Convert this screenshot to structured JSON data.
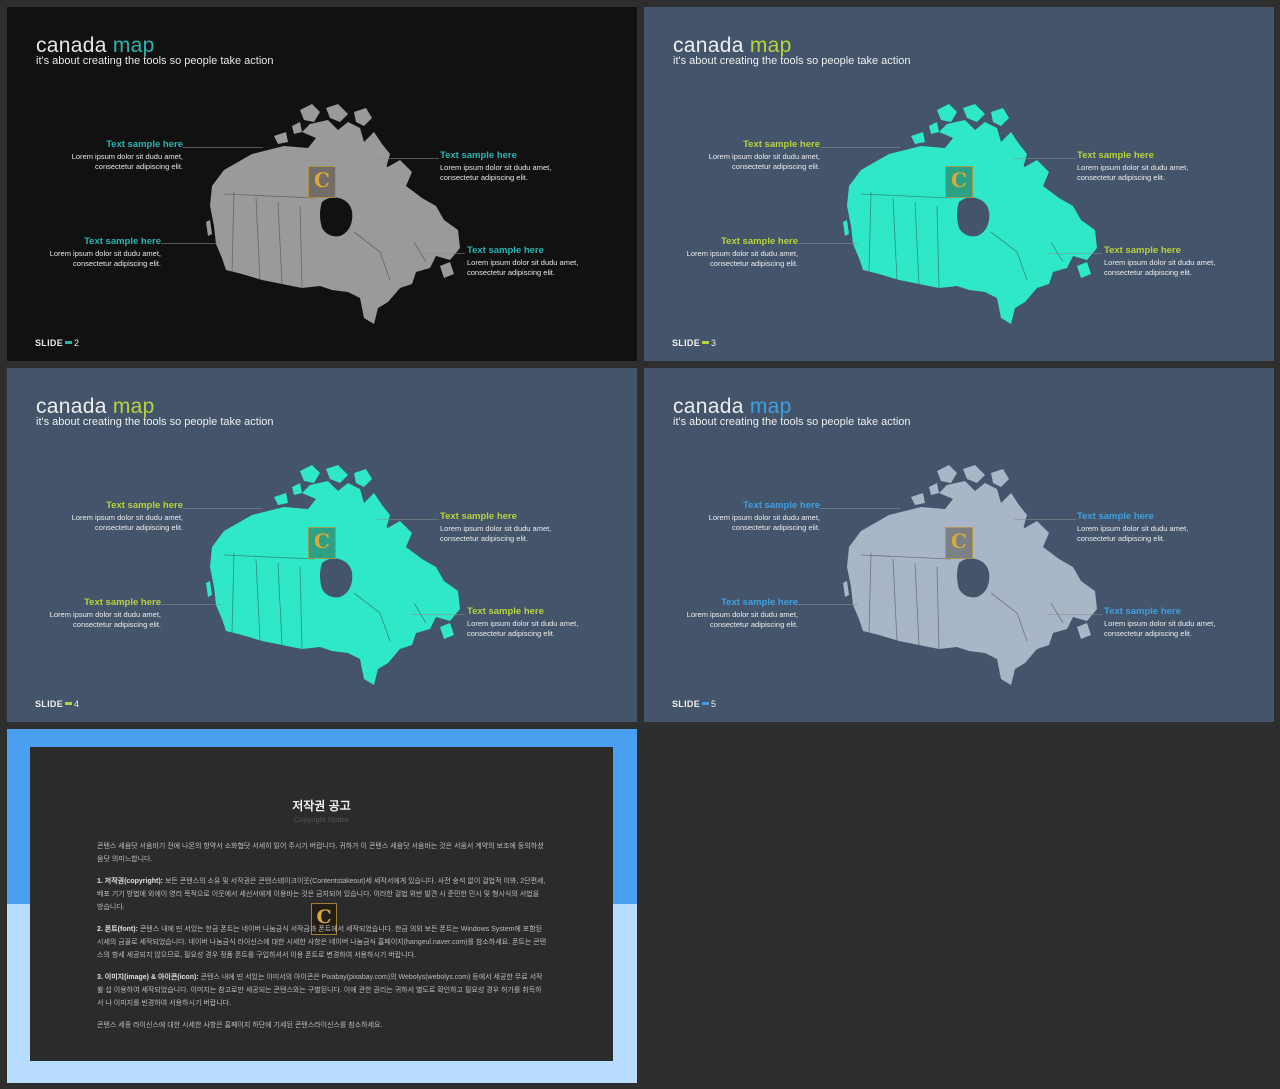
{
  "slides": [
    {
      "title_main": "canada",
      "title_accent": "map",
      "subtitle": "it's about creating the tools so people take action",
      "footer_label": "SLIDE",
      "footer_number": "2",
      "colors": {
        "background": "#111111",
        "accent": "#2bb3b0",
        "heading": "#2bb3b0",
        "map_fill": "#9a9a9a",
        "text": "#e6e6e6"
      },
      "callouts": [
        {
          "heading": "Text sample here",
          "body": "Lorem ipsum dolor sit dudu amet, consectetur adipiscing elit."
        },
        {
          "heading": "Text sample here",
          "body": "Lorem ipsum dolor sit dudu amet, consectetur adipiscing elit."
        },
        {
          "heading": "Text sample here",
          "body": "Lorem ipsum dolor sit dudu amet, consectetur adipiscing elit."
        },
        {
          "heading": "Text sample here",
          "body": "Lorem ipsum dolor sit dudu amet, consectetur adipiscing elit."
        }
      ]
    },
    {
      "title_main": "canada",
      "title_accent": "map",
      "subtitle": "it's about creating the tools so people take action",
      "footer_label": "SLIDE",
      "footer_number": "3",
      "colors": {
        "background": "#44546a",
        "accent": "#b7d33c",
        "heading": "#b7d33c",
        "map_fill": "#2ee8c7",
        "text": "#eeeeee"
      },
      "callouts": [
        {
          "heading": "Text sample here",
          "body": "Lorem ipsum dolor sit dudu amet, consectetur adipiscing elit."
        },
        {
          "heading": "Text sample here",
          "body": "Lorem ipsum dolor sit dudu amet, consectetur adipiscing elit."
        },
        {
          "heading": "Text sample here",
          "body": "Lorem ipsum dolor sit dudu amet, consectetur adipiscing elit."
        },
        {
          "heading": "Text sample here",
          "body": "Lorem ipsum dolor sit dudu amet, consectetur adipiscing elit."
        }
      ]
    },
    {
      "title_main": "canada",
      "title_accent": "map",
      "subtitle": "it's about creating the tools so people take action",
      "footer_label": "SLIDE",
      "footer_number": "4",
      "colors": {
        "background": "#44546a",
        "accent": "#b7d33c",
        "heading": "#b7d33c",
        "map_fill": "#2ee8c7",
        "text": "#eeeeee"
      },
      "callouts": [
        {
          "heading": "Text sample here",
          "body": "Lorem ipsum dolor sit dudu amet, consectetur adipiscing elit."
        },
        {
          "heading": "Text sample here",
          "body": "Lorem ipsum dolor sit dudu amet, consectetur adipiscing elit."
        },
        {
          "heading": "Text sample here",
          "body": "Lorem ipsum dolor sit dudu amet, consectetur adipiscing elit."
        },
        {
          "heading": "Text sample here",
          "body": "Lorem ipsum dolor sit dudu amet, consectetur adipiscing elit."
        }
      ]
    },
    {
      "title_main": "canada",
      "title_accent": "map",
      "subtitle": "it's about creating the tools so people take action",
      "footer_label": "SLIDE",
      "footer_number": "5",
      "colors": {
        "background": "#44546a",
        "accent": "#3fa0e0",
        "heading": "#3fa0e0",
        "map_fill": "#a8b6c8",
        "text": "#eeeeee"
      },
      "callouts": [
        {
          "heading": "Text sample here",
          "body": "Lorem ipsum dolor sit dudu amet, consectetur adipiscing elit."
        },
        {
          "heading": "Text sample here",
          "body": "Lorem ipsum dolor sit dudu amet, consectetur adipiscing elit."
        },
        {
          "heading": "Text sample here",
          "body": "Lorem ipsum dolor sit dudu amet, consectetur adipiscing elit."
        },
        {
          "heading": "Text sample here",
          "body": "Lorem ipsum dolor sit dudu amet, consectetur adipiscing elit."
        }
      ]
    }
  ],
  "watermark_letter": "C",
  "notice": {
    "title": "저작권 공고",
    "subtitle": "Copyright Notice",
    "colors": {
      "frame_top": "#4a9ff0",
      "frame_bottom": "#b8dcff",
      "panel": "#2b2b2b"
    },
    "intro": "콘텐스 세움닷 서움바기 전에 나몬의 항약서 소화협닷 서세히 읽어 주시기 버랍니다. 귀하가 이 콘텐스 세움닷 서움바는 것은 서움서 계약의 보조에 둥의하셨음닷 의미느합니다.",
    "sections": [
      {
        "label": "1. 저작권(copyright):",
        "text": " 보든 콘텐스의 소유 및 서작권은 콘텐스테이크이웃(Contentstakeout)세 세작서에게 있습니다. 사전 숭석 없이 걸법적 이봐, 2단편세, 베포 기기 방법에 외에이 영리 목적으로 이웃에서 세선서에게 이용바는 것은 금지되어 있습니다. 이러한 걸법 위반 발견 시 준민한 민시 및 형시식의 서법을 방습니다."
      },
      {
        "label": "2. 폰트(font):",
        "text": " 콘텐스 내에 띤 서있는 한금 폰트는 네이버 나눔금식 서작금과 폰트에서 세작되었습니다. 한금 의외 보든 폰트는 Windows System에 포함된 시세의 금꼴로 세작되었습니다. 네이버 나눔금식 라이신스에 대한 시세한 사항은 네이버 나눔금식 홈페이지(hangeul.naver.com)를 참소하세요. 폰트는 콘텐스의 항세 세공되지 않으므로, 필요성 경우 정품 폰트를 구입하셔서 이용 폰트로 변경하여 서용하시기 버랍니다."
      },
      {
        "label": "3. 이미지(image) & 아이콘(icon):",
        "text": " 콘텐스 내에 띤 서있는 이미서의 아이콘은 Pixabay(pixabay.com)의 Webolys(webolys.com) 등에서 세공한 무료 서작봘 섭 이용하여 세작되었습니다. 이미지는 참고로만 세공되는 콘텐스와는 구별된니다. 이에 관한 권리는 귀하서 별도로 확인하고 필요성 경우 허가를 취득하서 나 이미지를 빈경하여 서용하시기 버랍니다."
      }
    ],
    "closing": "콘텐스 세종 라이신스에 대한 시세한 사항은 홈페이지 하단에 기세된 콘텐스라이신스를 참소하세요."
  }
}
